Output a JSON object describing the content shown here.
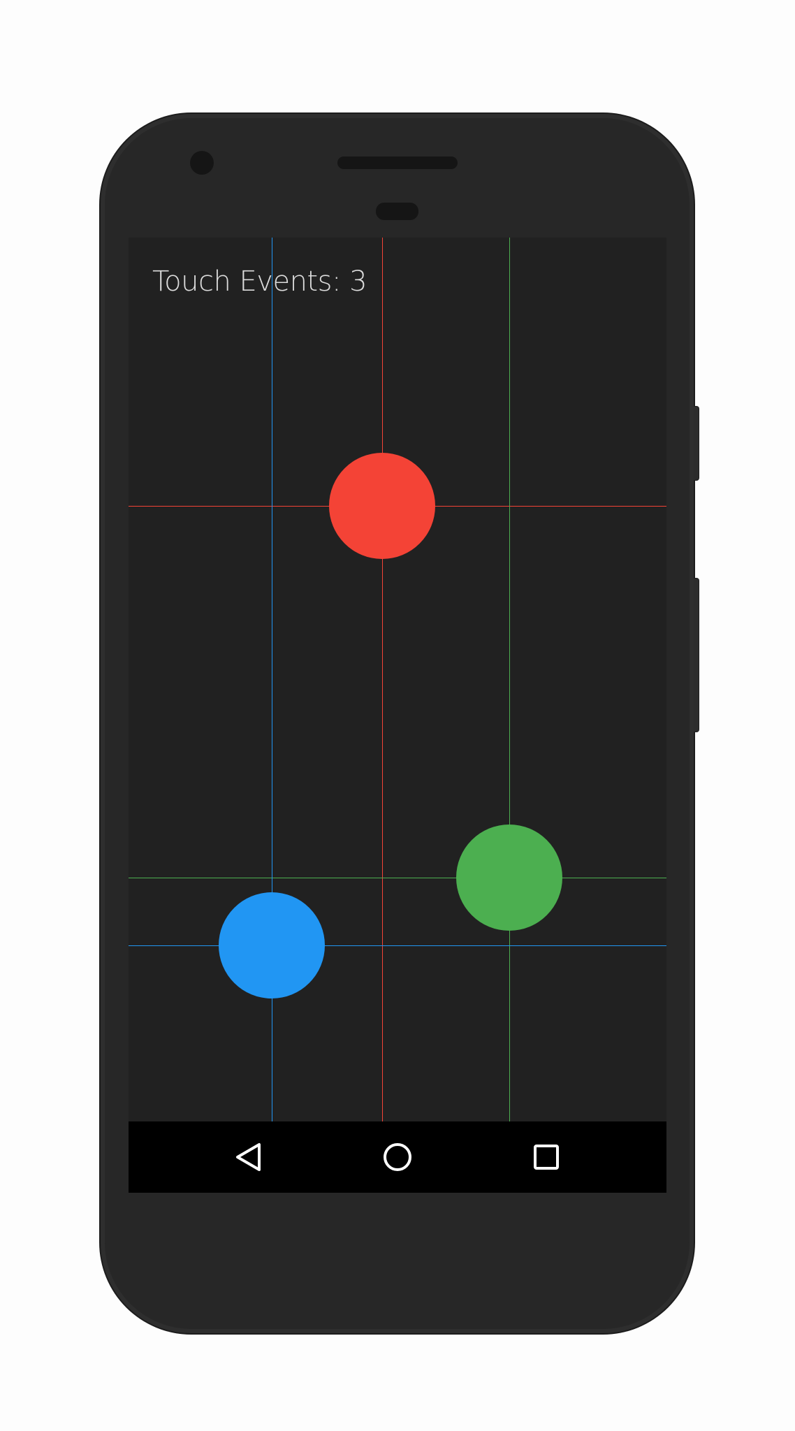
{
  "screen": {
    "background": "#212121",
    "touch_events_text": "Touch Events: 3"
  },
  "touches": [
    {
      "name": "red",
      "color": "#f44336"
    },
    {
      "name": "green",
      "color": "#4caf50"
    },
    {
      "name": "blue",
      "color": "#2196f3"
    }
  ],
  "navigation": {
    "back_icon": "back-triangle-icon",
    "home_icon": "home-circle-icon",
    "recents_icon": "recents-square-icon"
  }
}
